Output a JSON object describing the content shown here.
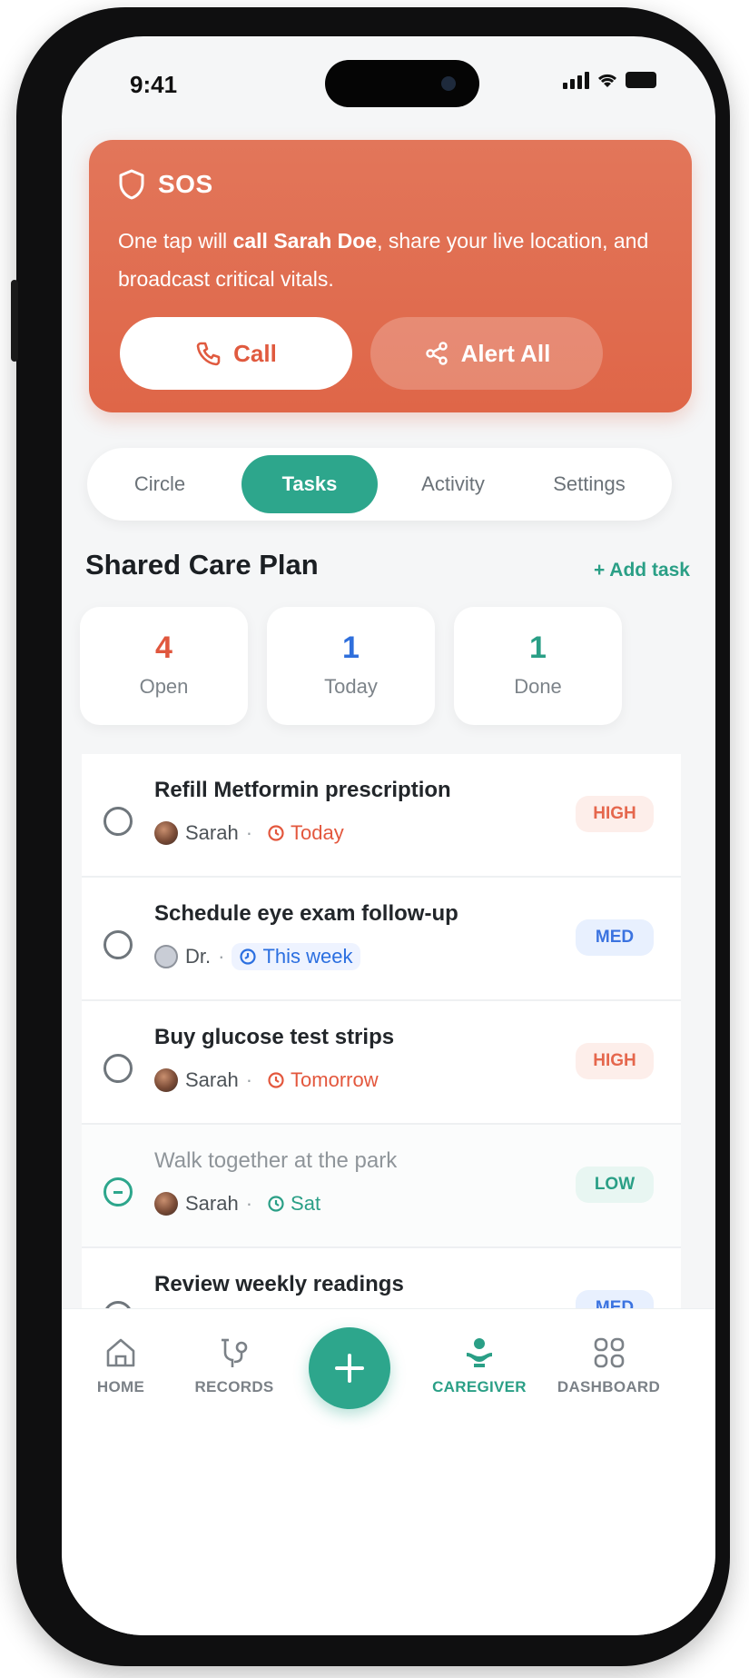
{
  "status_bar": {
    "time": "9:41"
  },
  "sos": {
    "title": "SOS",
    "desc_prefix": "One tap will ",
    "desc_bold1": "call Sarah Doe",
    "desc_mid": ", share your live location, and broadcast critical vitals.",
    "call_label": "Call",
    "alert_label": "Alert All",
    "colors": {
      "card": "#e06d52",
      "accent": "#e05a3f"
    }
  },
  "tabs": [
    {
      "label": "Circle",
      "active": false
    },
    {
      "label": "Tasks",
      "active": true
    },
    {
      "label": "Activity",
      "active": false
    },
    {
      "label": "Settings",
      "active": false
    }
  ],
  "plan": {
    "title": "Shared Care Plan",
    "add_task": "+ Add task",
    "stats": [
      {
        "value": "4",
        "label": "Open",
        "color": "#e0573e"
      },
      {
        "value": "1",
        "label": "Today",
        "color": "#2f6fdc"
      },
      {
        "value": "1",
        "label": "Done",
        "color": "#2a9f86"
      }
    ]
  },
  "tasks": [
    {
      "title": "Refill Metformin prescription",
      "assignee": "Sarah",
      "due": "Today",
      "due_color": "red",
      "priority": "HIGH",
      "priority_class": "high",
      "done": false,
      "avatar": "photo",
      "due_icon": "clock-icon"
    },
    {
      "title": "Schedule eye exam follow-up",
      "assignee": "Dr.",
      "due": "This week",
      "due_color": "blue",
      "priority": "MED",
      "priority_class": "med",
      "done": false,
      "avatar": "doctor",
      "due_icon": "calendar-icon"
    },
    {
      "title": "Buy glucose test strips",
      "assignee": "Sarah",
      "due": "Tomorrow",
      "due_color": "red",
      "priority": "HIGH",
      "priority_class": "high",
      "done": false,
      "avatar": "photo",
      "due_icon": "clock-icon"
    },
    {
      "title": "Walk together at the park",
      "assignee": "Sarah",
      "due": "Sat",
      "due_color": "green",
      "priority": "LOW",
      "priority_class": "low",
      "done": true,
      "avatar": "photo",
      "due_icon": "clock-icon"
    },
    {
      "title": "Review weekly readings",
      "assignee": "",
      "due": "",
      "due_color": "blue",
      "priority": "MED",
      "priority_class": "med",
      "done": false,
      "avatar": "",
      "due_icon": ""
    }
  ],
  "nav": [
    {
      "label": "HOME",
      "icon": "home-icon",
      "active": false
    },
    {
      "label": "RECORDS",
      "icon": "records-icon",
      "active": false
    },
    {
      "label": "CAREGIVER",
      "icon": "caregiver-icon",
      "active": true
    },
    {
      "label": "DASHBOARD",
      "icon": "dashboard-icon",
      "active": false
    }
  ],
  "fab": {
    "icon": "plus-icon"
  }
}
